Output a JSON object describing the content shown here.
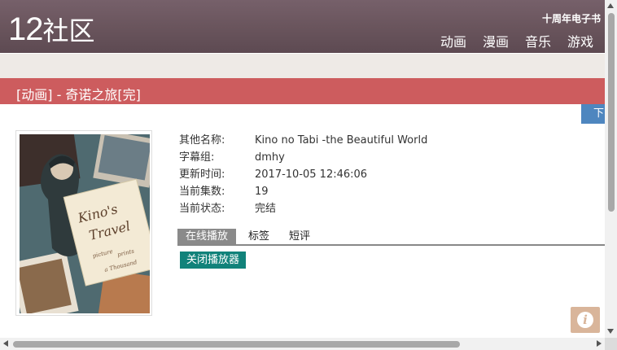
{
  "site": {
    "logo_num": "12",
    "logo_cn": "社区",
    "ebook_link": "十周年电子书"
  },
  "nav": {
    "items": [
      {
        "label": "动画"
      },
      {
        "label": "漫画"
      },
      {
        "label": "音乐"
      },
      {
        "label": "游戏"
      }
    ]
  },
  "page": {
    "title": "[动画] - 奇诺之旅[完]",
    "download_tab": "下"
  },
  "details": {
    "rows": [
      {
        "label": "其他名称:",
        "value": "Kino no Tabi -the Beautiful World"
      },
      {
        "label": "字幕组:",
        "value": "dmhy"
      },
      {
        "label": "更新时间:",
        "value": "2017-10-05 12:46:06"
      },
      {
        "label": "当前集数:",
        "value": "19"
      },
      {
        "label": "当前状态:",
        "value": "完结"
      }
    ]
  },
  "cover": {
    "title_lines": [
      "Kino's",
      "Travel"
    ],
    "subtitle_lines": [
      "picture",
      "prints",
      "a Thousand"
    ]
  },
  "tabs": [
    {
      "label": "在线播放",
      "active": true
    },
    {
      "label": "标签",
      "active": false
    },
    {
      "label": "短评",
      "active": false
    }
  ],
  "player": {
    "close_label": "关闭播放器"
  },
  "info_button": {
    "glyph": "i"
  },
  "colors": {
    "header": "#6a555d",
    "title_bar": "#cd5c5e",
    "close_button": "#11827a",
    "download_tab": "#4e86bf"
  }
}
